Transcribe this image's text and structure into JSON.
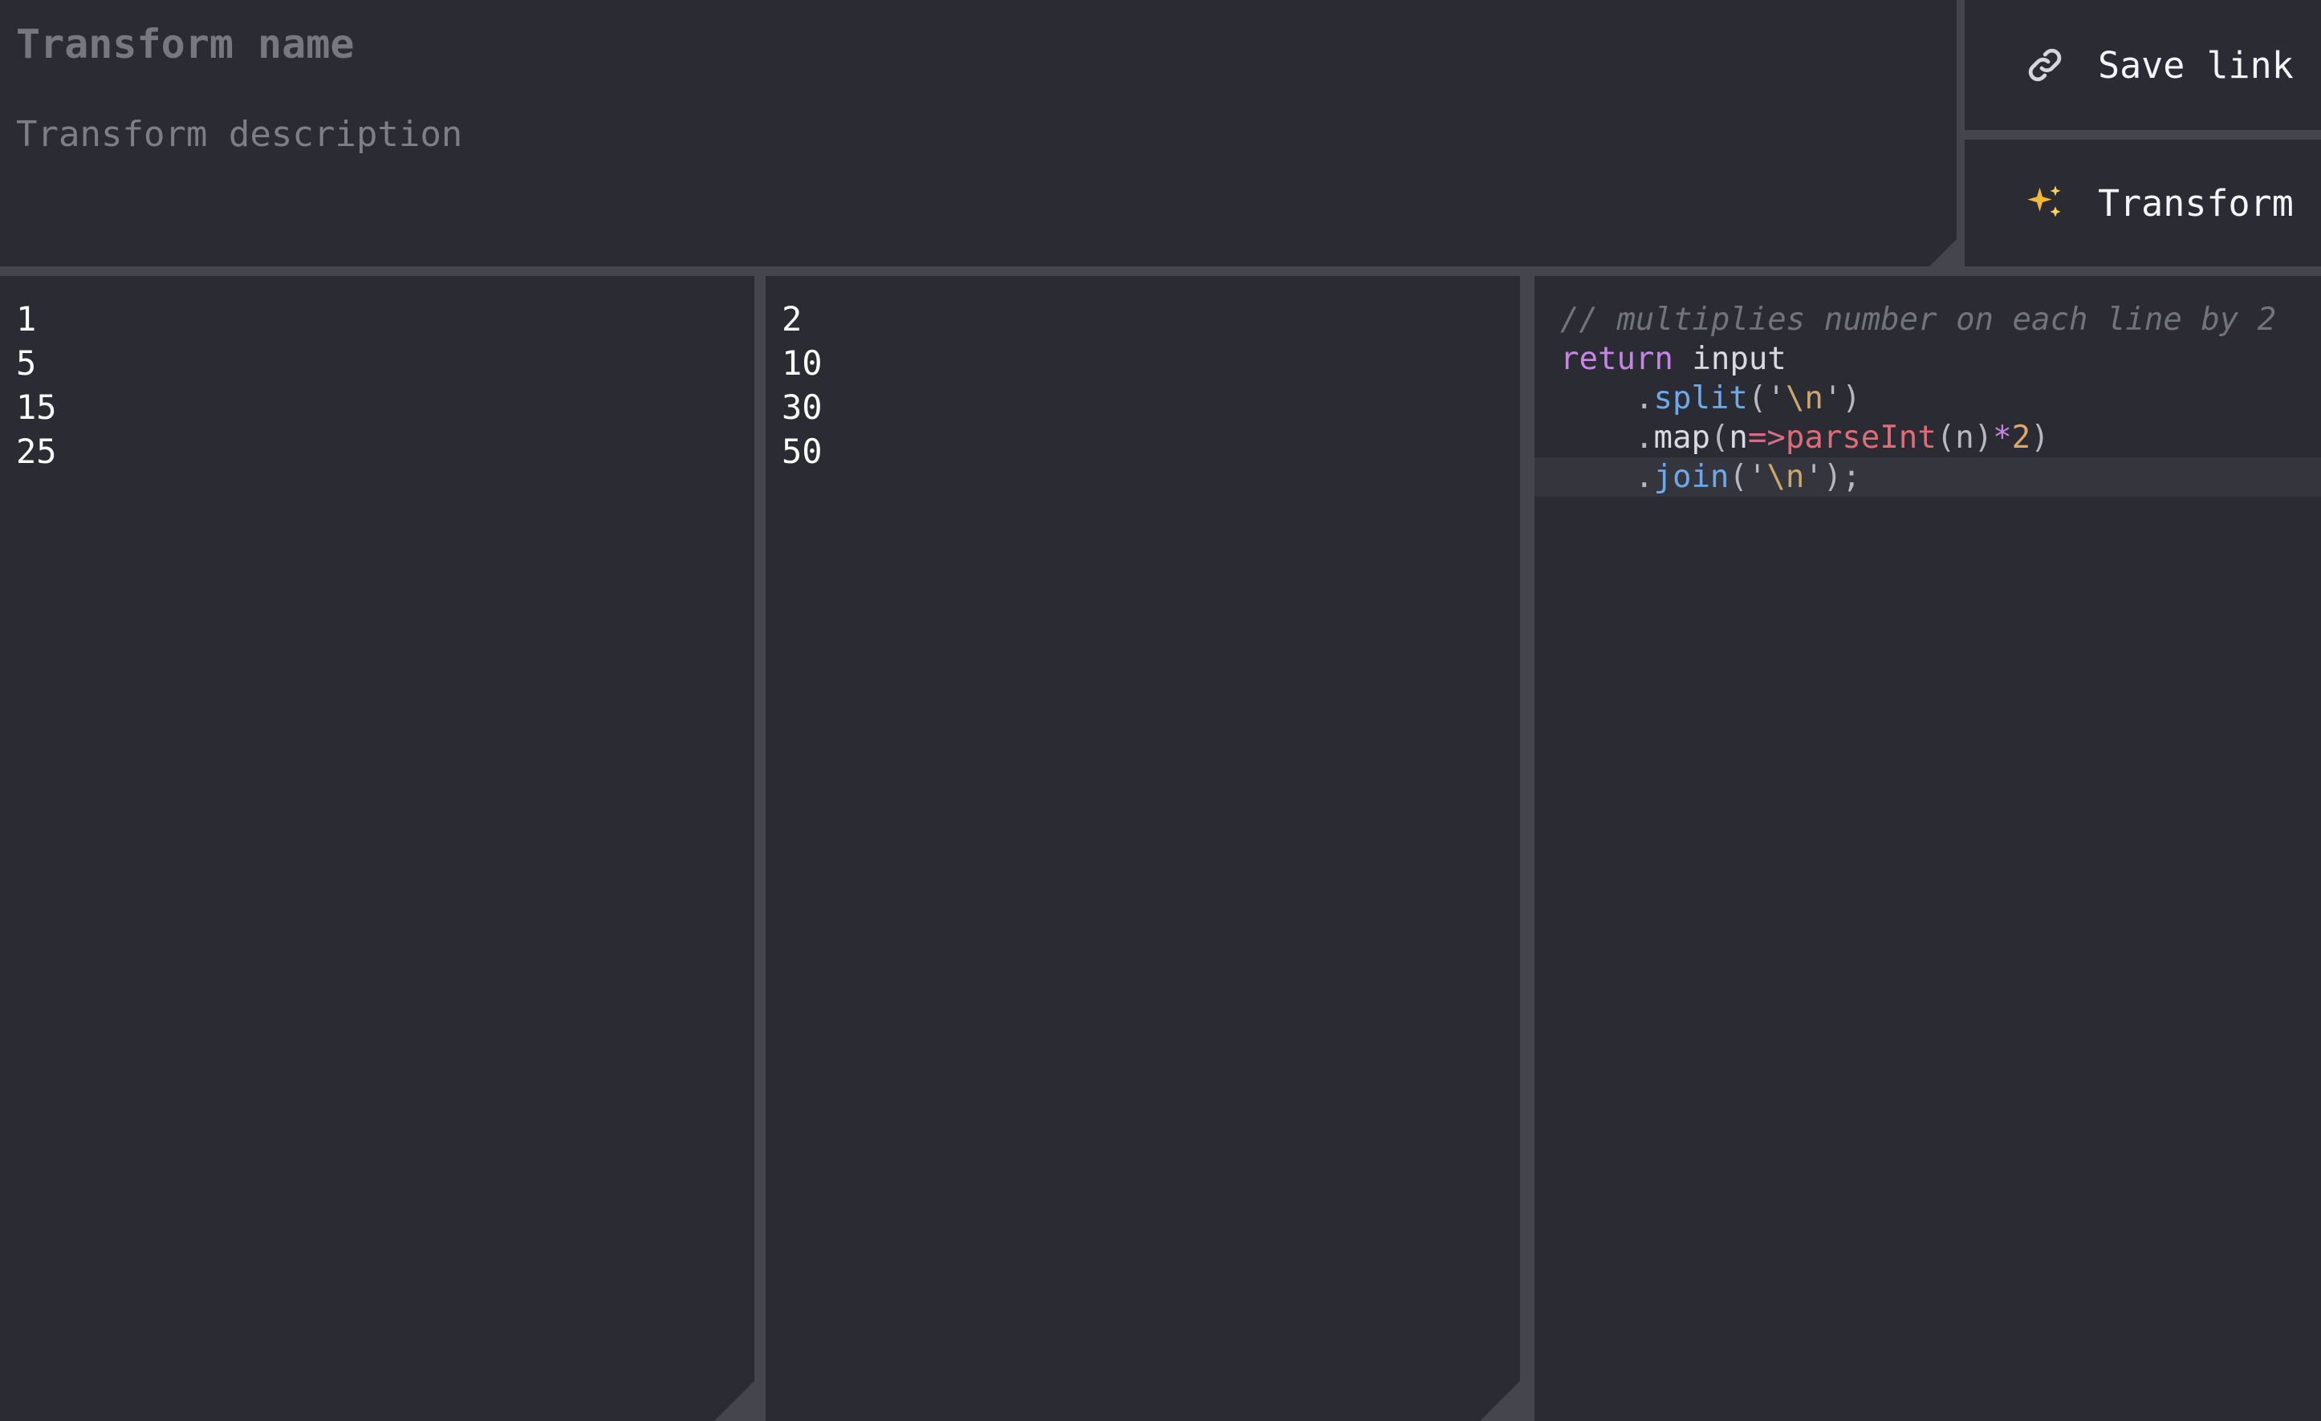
{
  "header": {
    "name_placeholder": "Transform name",
    "description_placeholder": "Transform description",
    "name_value": "",
    "description_value": ""
  },
  "actions": {
    "save_link": {
      "label": "Save link",
      "icon": "link-icon"
    },
    "transform": {
      "label": "Transform",
      "icon": "sparkles-icon"
    }
  },
  "input_pane": {
    "value": "1\n5\n15\n25"
  },
  "output_pane": {
    "value": "2\n10\n30\n50"
  },
  "code_editor": {
    "active_line": 5,
    "lines": {
      "l1": {
        "comment": "// multiplies number on each line by 2"
      },
      "l2": {
        "keyword": "return",
        "ident": "input"
      },
      "l3": {
        "dot": ".",
        "method": "split",
        "open": "('",
        "escape": "\\n",
        "close": "')"
      },
      "l4": {
        "dot": ".",
        "method": "map",
        "open": "(",
        "param": "n",
        "arrow": "=>",
        "fn": "parseInt",
        "args": "(n)",
        "op": "*",
        "number": "2",
        "close": ")"
      },
      "l5": {
        "dot": ".",
        "method": "join",
        "open": "('",
        "escape": "\\n",
        "close": "');"
      }
    }
  },
  "colors": {
    "background": "#2b2c33",
    "gutter": "#44454d",
    "keyword": "#c685e6",
    "method": "#6ea8e8",
    "string": "#c9a86a",
    "function": "#e06c79",
    "number": "#e0a56c",
    "comment": "#72747c"
  }
}
